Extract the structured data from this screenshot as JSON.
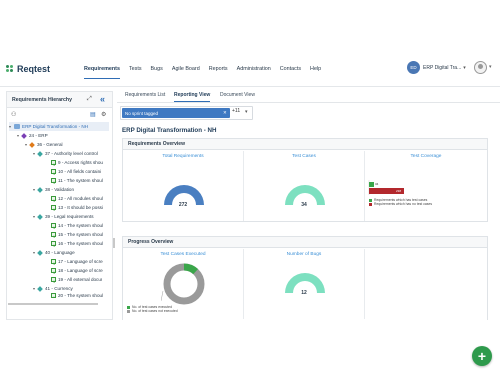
{
  "app": {
    "logo_text": "Reqtest"
  },
  "nav": {
    "items": [
      {
        "label": "Requirements",
        "active": true
      },
      {
        "label": "Tests",
        "active": false
      },
      {
        "label": "Bugs",
        "active": false
      },
      {
        "label": "Agile Board",
        "active": false
      },
      {
        "label": "Reports",
        "active": false
      },
      {
        "label": "Administration",
        "active": false
      },
      {
        "label": "Contacts",
        "active": false
      },
      {
        "label": "Help",
        "active": false
      }
    ],
    "project_initials": "ED",
    "project_name": "ERP Digital Tra...",
    "project_chevron": "▾",
    "user_chevron": "▾"
  },
  "left_panel": {
    "title": "Requirements Hierarchy",
    "tree": [
      {
        "label": "ERP Digital Transformation - NH",
        "type": "root"
      },
      {
        "label": "24 - ERP",
        "type": "epic",
        "color": "#7b3fb5"
      },
      {
        "label": "36 - General",
        "type": "group",
        "color": "#e07b1a"
      },
      {
        "label": "37 - Authority level control",
        "type": "group",
        "color": "#3aa6a0"
      },
      {
        "label": "9 - Access rights shou",
        "type": "req"
      },
      {
        "label": "10 - All fields containi",
        "type": "req"
      },
      {
        "label": "11 - The system shoul",
        "type": "req"
      },
      {
        "label": "38 - Validation",
        "type": "group",
        "color": "#3aa6a0"
      },
      {
        "label": "12 - All modules shoul",
        "type": "req"
      },
      {
        "label": "13 - It should be possi",
        "type": "req"
      },
      {
        "label": "39 - Legal requirements",
        "type": "group",
        "color": "#3aa6a0"
      },
      {
        "label": "14 - The system shoul",
        "type": "req"
      },
      {
        "label": "15 - The system shoul",
        "type": "req"
      },
      {
        "label": "16 - The system shoul",
        "type": "req"
      },
      {
        "label": "40 - Language",
        "type": "group",
        "color": "#3aa6a0"
      },
      {
        "label": "17 - Language of scre",
        "type": "req"
      },
      {
        "label": "18 - Language of scre",
        "type": "req"
      },
      {
        "label": "19 - All external docur",
        "type": "req"
      },
      {
        "label": "41 - Currency",
        "type": "group",
        "color": "#3aa6a0"
      },
      {
        "label": "20 - The system shoul",
        "type": "req"
      }
    ]
  },
  "tabs": [
    {
      "label": "Requirements List",
      "active": false
    },
    {
      "label": "Reporting View",
      "active": true
    },
    {
      "label": "Document View",
      "active": false
    }
  ],
  "sprint": {
    "chip": "No sprint tagged",
    "chip_close": "✕",
    "more": "+11",
    "chevron": "▾"
  },
  "page_title": "ERP Digital Transformation - NH",
  "requirements_overview": {
    "heading": "Requirements Overview",
    "total_requirements": {
      "title": "Total Requirements",
      "value": "272",
      "color": "#4a7fc1"
    },
    "test_cases": {
      "title": "Test Cases",
      "value": "34",
      "color": "#7de0c0"
    },
    "test_coverage": {
      "title": "Test Coverage",
      "bar_small_label": "34",
      "bar_big_label": "238",
      "legend": [
        {
          "label": "Requirements which has test cases",
          "color": "#3aa64a"
        },
        {
          "label": "Requirements which has no test cases",
          "color": "#b3282d"
        }
      ]
    }
  },
  "progress_overview": {
    "heading": "Progress Overview",
    "test_cases_executed": {
      "title": "Test Cases Executed",
      "legend": [
        {
          "label": "No. of test cases executed",
          "color": "#3aa64a"
        },
        {
          "label": "No. of test cases not executed",
          "color": "#9a9a9a"
        }
      ],
      "executed_fraction": 0.12
    },
    "number_of_bugs": {
      "title": "Number of Bugs",
      "value": "12",
      "color": "#7de0c0"
    }
  }
}
